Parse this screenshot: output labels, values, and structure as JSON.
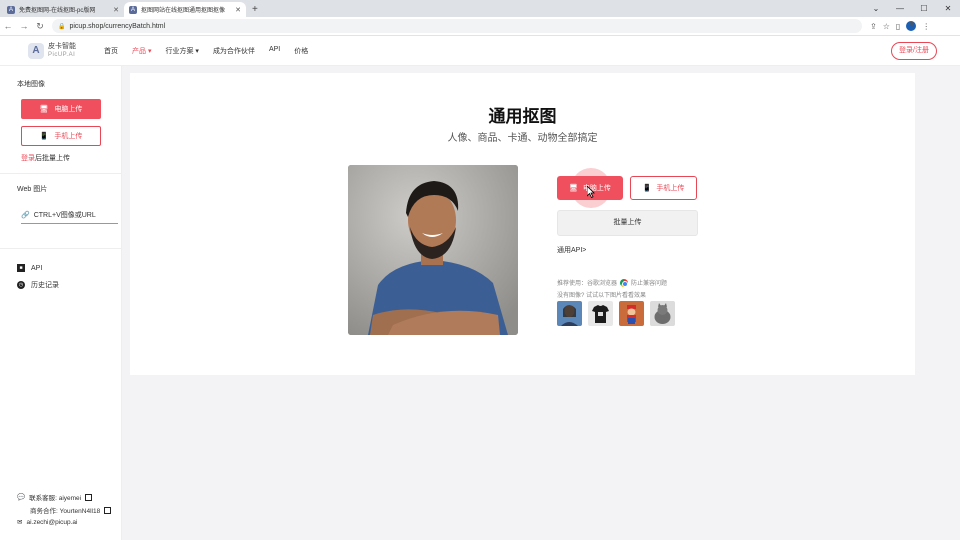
{
  "browser": {
    "tabs": [
      {
        "title": "免费抠图网-在线抠图-pc版网",
        "active": false
      },
      {
        "title": "抠图网站在线抠图通用抠图抠像",
        "active": true
      }
    ],
    "url": "picup.shop/currencyBatch.html"
  },
  "header": {
    "logo_cn": "皮卡智能",
    "logo_en": "PicUP.AI",
    "nav": [
      "首页",
      "产品 ▾",
      "行业方案 ▾",
      "成为合作伙伴",
      "API",
      "价格"
    ],
    "login_label": "登录/注册"
  },
  "sidebar": {
    "local_title": "本地图像",
    "pc_upload": "电脑上传",
    "phone_upload": "手机上传",
    "batch_prefix": "登录",
    "batch_suffix": "后批量上传",
    "web_title": "Web 图片",
    "url_hint": "CTRL+V图像或URL",
    "api_label": "API",
    "history_label": "历史记录",
    "footer": [
      "联系客服: aiyemei",
      "商务合作: YourtenN4ll18",
      "ai.zechi@picup.ai"
    ]
  },
  "main": {
    "title": "通用抠图",
    "subtitle": "人像、商品、卡通、动物全部搞定",
    "upload_btn": "电脑上传",
    "phone_btn": "手机上传",
    "batch_btn": "批量上传",
    "api_link": "通用API>",
    "hint_browser_prefix": "推荐使用：谷歌浏览器",
    "hint_browser_suffix": "防止兼容问题",
    "hint_samples": "没有图像? 试试以下图片看看效果",
    "thumbs": [
      "sample-portrait",
      "sample-tshirt",
      "sample-cartoon",
      "sample-cat"
    ]
  },
  "colors": {
    "accent": "#f0505e",
    "accent_border": "#e84855"
  }
}
